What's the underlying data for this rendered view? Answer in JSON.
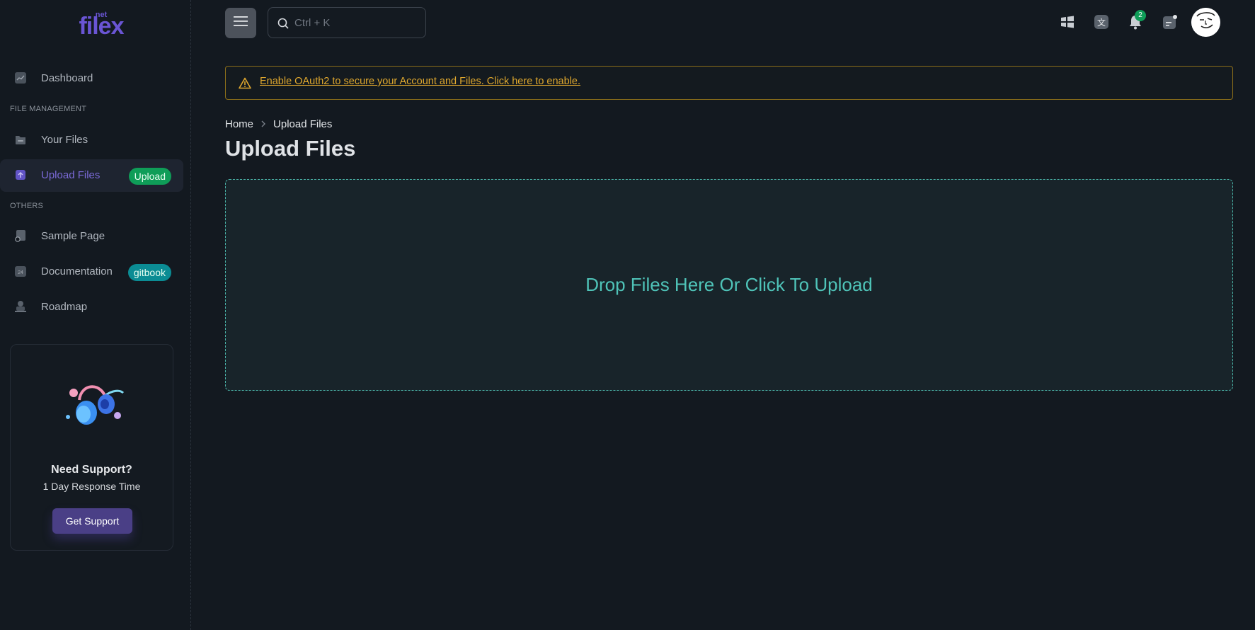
{
  "app": {
    "logo_text": "filex",
    "logo_sub": "net"
  },
  "sidebar": {
    "items": [
      {
        "label": "Dashboard"
      },
      {
        "label": "Your Files"
      },
      {
        "label": "Upload Files",
        "badge": "Upload"
      },
      {
        "label": "Sample Page"
      },
      {
        "label": "Documentation",
        "badge": "gitbook"
      },
      {
        "label": "Roadmap"
      }
    ],
    "sections": [
      "FILE MANAGEMENT",
      "OTHERS"
    ],
    "calendar_icon_text": "24"
  },
  "support": {
    "title": "Need Support?",
    "subtitle": "1 Day Response Time",
    "button": "Get Support"
  },
  "topbar": {
    "search_placeholder": "Ctrl + K",
    "notification_count": "2",
    "translate_icon_text": "文"
  },
  "alert": {
    "text": "Enable OAuth2 to secure your Account and Files. Click here to enable."
  },
  "breadcrumb": [
    "Home",
    "Upload Files"
  ],
  "page": {
    "title": "Upload Files"
  },
  "dropzone": {
    "text": "Drop Files Here Or Click To Upload"
  },
  "colors": {
    "background": "#131920",
    "accent": "#7b6ad8",
    "badge_green": "#0f9d58",
    "badge_teal": "#0b8c94",
    "warning": "#e0a82e",
    "dropzone_text": "#4fc3b8"
  }
}
